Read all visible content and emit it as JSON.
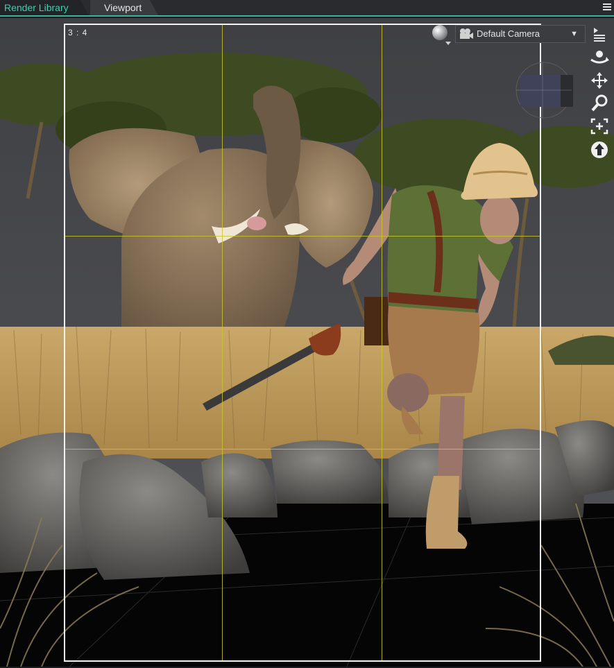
{
  "tabs": [
    {
      "label": "Render Library",
      "active": false
    },
    {
      "label": "Viewport",
      "active": true
    }
  ],
  "viewport": {
    "aspect_ratio_label": "3 : 4",
    "camera": {
      "selected": "Default Camera"
    }
  },
  "icons": {
    "tab_menu": "menu-lines-icon",
    "viewport_menu": "menu-lines-icon",
    "render_sphere": "sphere-icon",
    "camera": "camera-icon",
    "orbit": "orbit-icon",
    "pan": "move-arrows-icon",
    "zoom": "magnifier-icon",
    "frame": "frame-selection-icon",
    "up": "up-arrow-icon"
  },
  "colors": {
    "accent": "#38d3b0",
    "grid": "#c9c62a",
    "frame": "#f2f2f2"
  }
}
